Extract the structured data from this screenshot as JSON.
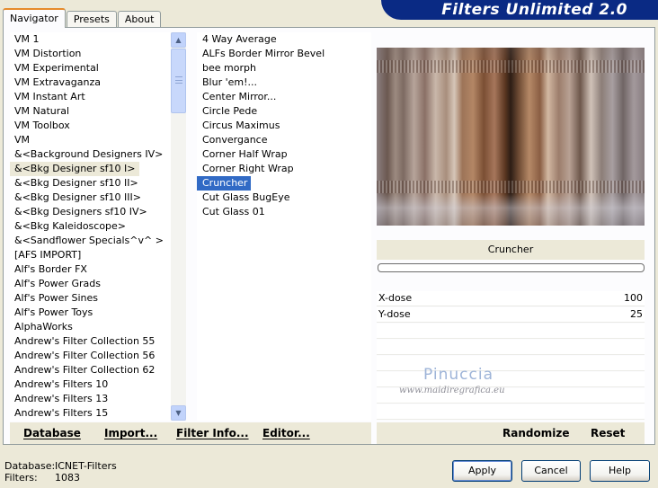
{
  "header": {
    "title": "Filters Unlimited 2.0"
  },
  "tabs": [
    {
      "label": "Navigator",
      "active": true
    },
    {
      "label": "Presets",
      "active": false
    },
    {
      "label": "About",
      "active": false
    }
  ],
  "categories": [
    "VM 1",
    "VM Distortion",
    "VM Experimental",
    "VM Extravaganza",
    "VM Instant Art",
    "VM Natural",
    "VM Toolbox",
    "VM",
    "&<Background Designers IV>",
    "&<Bkg Designer sf10 I>",
    "&<Bkg Designer sf10 II>",
    "&<Bkg Designer sf10 III>",
    "&<Bkg Designers sf10 IV>",
    "&<Bkg Kaleidoscope>",
    "&<Sandflower Specials^v^ >",
    "[AFS IMPORT]",
    "Alf's Border FX",
    "Alf's Power Grads",
    "Alf's Power Sines",
    "Alf's Power Toys",
    "AlphaWorks",
    "Andrew's Filter Collection 55",
    "Andrew's Filter Collection 56",
    "Andrew's Filter Collection 62",
    "Andrew's Filters 10",
    "Andrew's Filters 13",
    "Andrew's Filters 15"
  ],
  "selected_category": "&<Bkg Designer sf10 I>",
  "filters": [
    "4 Way Average",
    "ALFs Border Mirror Bevel",
    "bee morph",
    "Blur 'em!...",
    "Center Mirror...",
    "Circle Pede",
    "Circus Maximus",
    "Convergance",
    "Corner Half Wrap",
    "Corner Right Wrap",
    "Cruncher",
    "Cut Glass  BugEye",
    "Cut Glass 01"
  ],
  "selected_filter": "Cruncher",
  "filter_panel": {
    "name": "Cruncher",
    "params": [
      {
        "label": "X-dose",
        "value": "100"
      },
      {
        "label": "Y-dose",
        "value": "25"
      }
    ]
  },
  "watermark": {
    "name": "Pinuccia",
    "url": "www.maidiregrafica.eu"
  },
  "left_toolbar": {
    "database": "Database",
    "import": "Import...",
    "filter_info": "Filter Info...",
    "editor": "Editor..."
  },
  "right_toolbar": {
    "randomize": "Randomize",
    "reset": "Reset"
  },
  "status": {
    "database_label": "Database:",
    "database_value": "ICNET-Filters",
    "filters_label": "Filters:",
    "filters_value": "1083"
  },
  "buttons": {
    "apply": "Apply",
    "cancel": "Cancel",
    "help": "Help"
  }
}
